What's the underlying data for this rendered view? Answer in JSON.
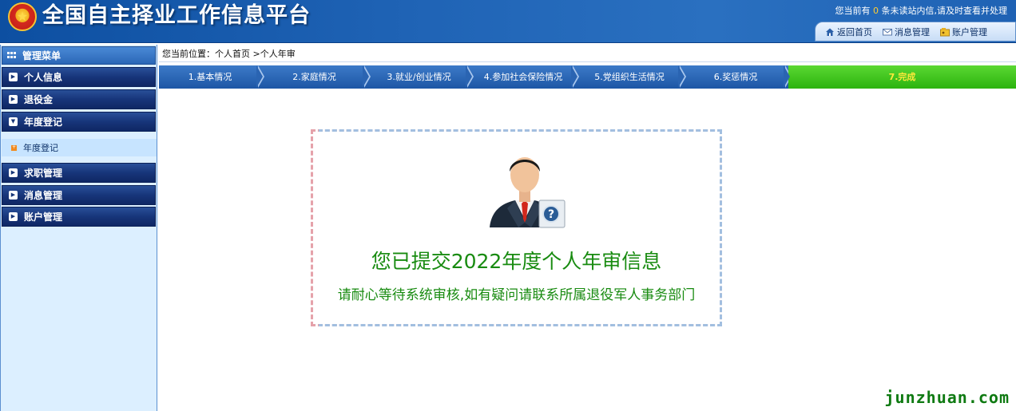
{
  "header": {
    "site_title": "全国自主择业工作信息平台",
    "notice_prefix": "您当前有",
    "unread_count": "0",
    "notice_suffix": "条未读站内信,请及时查看并处理",
    "nav": [
      {
        "label": "返回首页",
        "icon": "home-icon"
      },
      {
        "label": "消息管理",
        "icon": "mail-icon"
      },
      {
        "label": "账户管理",
        "icon": "account-icon"
      }
    ]
  },
  "sidebar": {
    "title": "管理菜单",
    "items": [
      {
        "label": "个人信息",
        "icon": "expand-icon"
      },
      {
        "label": "退役金",
        "icon": "expand-icon"
      },
      {
        "label": "年度登记",
        "icon": "collapse-icon"
      },
      {
        "label": "求职管理",
        "icon": "expand-icon"
      },
      {
        "label": "消息管理",
        "icon": "expand-icon"
      },
      {
        "label": "账户管理",
        "icon": "expand-icon"
      }
    ],
    "sub_items": [
      {
        "label": "年度登记",
        "icon": "bullet-icon"
      }
    ]
  },
  "breadcrumb": "您当前位置：个人首页 >个人年审",
  "steps": [
    {
      "label": "1.基本情况"
    },
    {
      "label": "2.家庭情况"
    },
    {
      "label": "3.就业/创业情况"
    },
    {
      "label": "4.参加社会保险情况"
    },
    {
      "label": "5.党组织生活情况"
    },
    {
      "label": "6.奖惩情况"
    },
    {
      "label": "7.完成"
    }
  ],
  "main": {
    "title": "您已提交2022年度个人年审信息",
    "subtitle": "请耐心等待系统审核,如有疑问请联系所属退役军人事务部门"
  },
  "watermark": "junzhuan.com",
  "colors": {
    "header_blue": "#1f63b5",
    "menu_dark": "#17357a",
    "active_step": "#3cc71b",
    "message_green": "#188b10"
  }
}
